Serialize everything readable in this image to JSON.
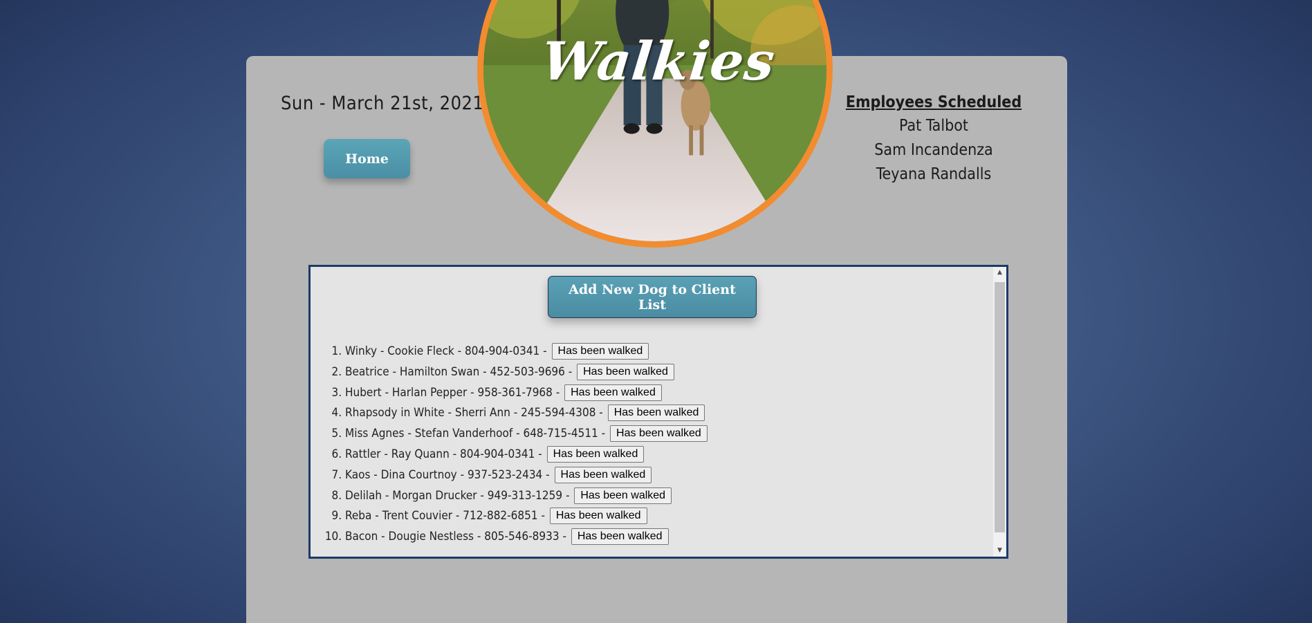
{
  "header": {
    "date": "Sun - March 21st, 2021",
    "home_label": "Home",
    "logo_text": "Walkies"
  },
  "employees": {
    "title": "Employees Scheduled",
    "names": [
      "Pat Talbot",
      "Sam Incandenza",
      "Teyana Randalls"
    ]
  },
  "client_panel": {
    "add_label": "Add New Dog to Client List",
    "walk_button_label": "Has been walked",
    "dogs": [
      {
        "text": "Winky - Cookie Fleck - 804-904-0341 -"
      },
      {
        "text": "Beatrice - Hamilton Swan - 452-503-9696 -"
      },
      {
        "text": "Hubert - Harlan Pepper - 958-361-7968 -"
      },
      {
        "text": "Rhapsody in White - Sherri Ann - 245-594-4308 -"
      },
      {
        "text": "Miss Agnes - Stefan Vanderhoof - 648-715-4511 -"
      },
      {
        "text": "Rattler - Ray Quann - 804-904-0341 -"
      },
      {
        "text": "Kaos - Dina Courtnoy - 937-523-2434 -"
      },
      {
        "text": "Delilah - Morgan Drucker - 949-313-1259 -"
      },
      {
        "text": "Reba - Trent Couvier - 712-882-6851 -"
      },
      {
        "text": "Bacon - Dougie Nestless - 805-546-8933 -"
      }
    ]
  },
  "colors": {
    "accent_orange": "#f28c2f",
    "button_teal": "#4a8fa6",
    "panel_border": "#1c3a68",
    "card_bg": "#b6b6b6"
  },
  "icons": {
    "scroll_up": "scroll-up-arrow-icon",
    "scroll_down": "scroll-down-arrow-icon"
  }
}
